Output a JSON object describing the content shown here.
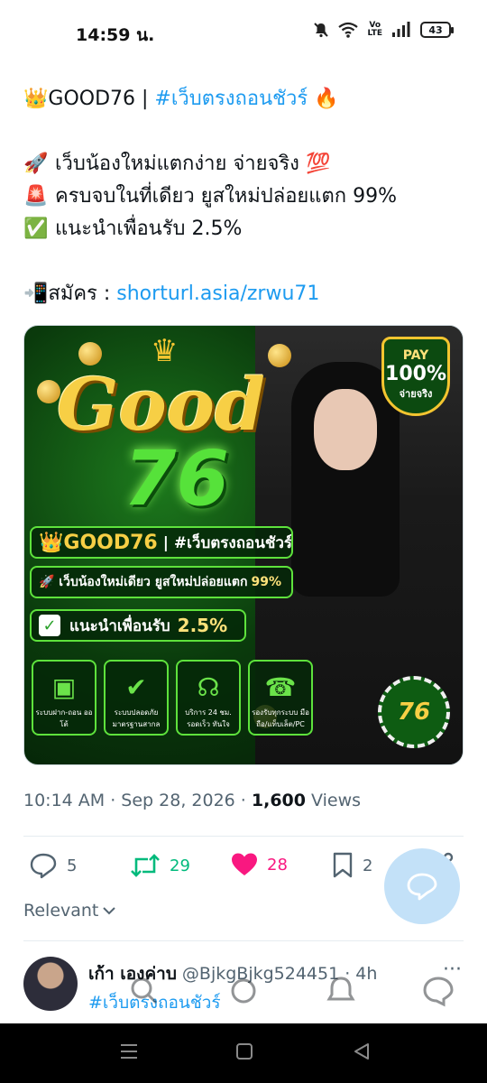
{
  "status_bar": {
    "time": "14:59 น.",
    "lte_top": "Vo",
    "lte_bottom": "LTE",
    "battery": "43"
  },
  "tweet": {
    "title_emoji": "👑",
    "title_text": "GOOD76 | ",
    "title_hashtag": "#เว็บตรงถอนชัวร์",
    "title_end_emoji": "🔥",
    "line1_emoji": "🚀",
    "line1_text": "เว็บน้องใหม่แตกง่าย จ่ายจริง",
    "line1_end_emoji": "💯",
    "line2_emoji": "🚨",
    "line2_text": "ครบจบในที่เดียว ยูสใหม่ปล่อยแตก 99%",
    "line3_emoji": "✅",
    "line3_text": "แนะนำเพื่อนรับ 2.5%",
    "signup_emoji": "📲",
    "signup_label": "สมัคร : ",
    "signup_link": "shorturl.asia/zrwu71"
  },
  "promo_image": {
    "logo_word": "Good",
    "logo_number": "76",
    "pay_line1": "PAY",
    "pay_line2": "100%",
    "pay_line3": "จ่ายจริง",
    "banner1_brand": "👑GOOD76",
    "banner1_tag": " | #เว็บตรงถอนชัวร์🔥",
    "banner2_text": "🚀 เว็บน้องใหม่เดียว ยูสใหม่ปล่อยแตก",
    "banner2_num": "99%",
    "banner3_check": "✓",
    "banner3_text": "แนะนำเพื่อนรับ",
    "banner3_num": "2.5%",
    "features": [
      {
        "icon": "wallet-icon",
        "glyph": "▣",
        "label": "ระบบฝาก-ถอน ออโต้"
      },
      {
        "icon": "shield-check-icon",
        "glyph": "✔",
        "label": "ระบบปลอดภัย มาตรฐานสากล"
      },
      {
        "icon": "headset-icon",
        "glyph": "☊",
        "label": "บริการ 24 ชม. รอดเร็ว ทันใจ"
      },
      {
        "icon": "phone-icon",
        "glyph": "☎",
        "label": "รองรับทุกระบบ มือถือ/แท็บเล็ต/PC"
      }
    ],
    "chip_text": "76"
  },
  "meta": {
    "time": "10:14 AM · Sep 28, 2026 · ",
    "views_count": "1,600",
    "views_label": " Views"
  },
  "actions": {
    "replies": "5",
    "retweets": "29",
    "likes": "28",
    "bookmarks": "2"
  },
  "sort_label": "Relevant",
  "reply": {
    "name": "เก้า เองค่าบ",
    "handle": "@BjkgBjkg524451 · 4h",
    "text": "#เว็บตรงถอนชัวร์",
    "more": "···"
  },
  "colors": {
    "link": "#1d9bf0",
    "retweet": "#00ba7c",
    "like": "#f91880",
    "muted": "#536471"
  }
}
